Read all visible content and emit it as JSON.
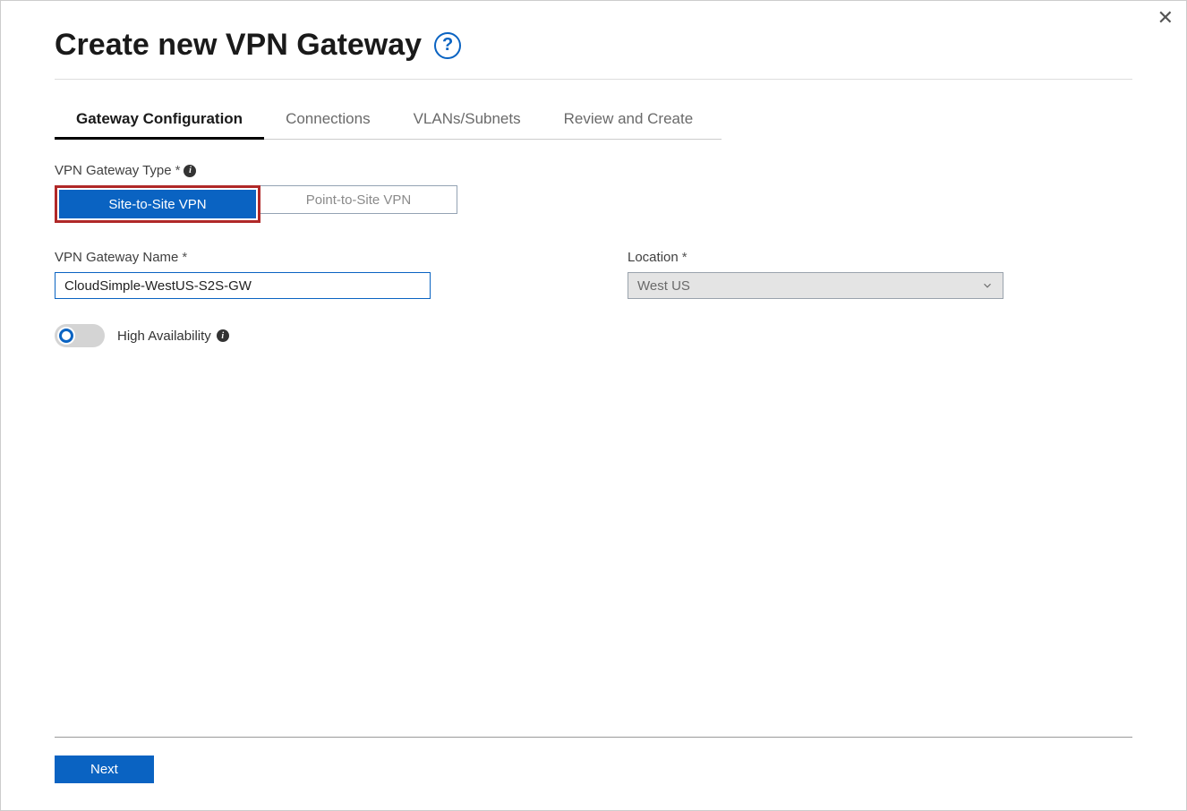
{
  "header": {
    "title": "Create new VPN Gateway"
  },
  "tabs": {
    "t0": "Gateway Configuration",
    "t1": "Connections",
    "t2": "VLANs/Subnets",
    "t3": "Review and Create"
  },
  "fields": {
    "type_label": "VPN Gateway Type",
    "type_opt_a": "Site-to-Site VPN",
    "type_opt_b": "Point-to-Site VPN",
    "name_label": "VPN Gateway Name",
    "name_value": "CloudSimple-WestUS-S2S-GW",
    "location_label": "Location",
    "location_value": "West US",
    "ha_label": "High Availability"
  },
  "footer": {
    "next": "Next"
  }
}
